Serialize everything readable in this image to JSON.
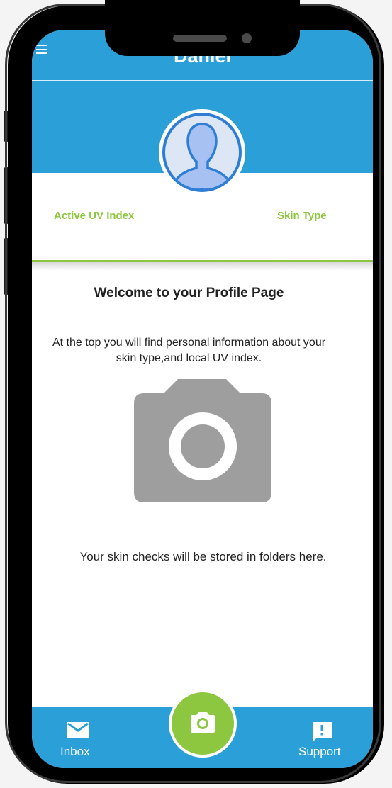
{
  "header": {
    "title": "Daniel",
    "menu_icon": "hamburger-menu-icon"
  },
  "profile": {
    "avatar_icon": "user-avatar-icon",
    "active_uv_label": "Active UV Index",
    "skin_type_label": "Skin Type"
  },
  "content": {
    "welcome_heading": "Welcome to your Profile Page",
    "intro_line1": "At the top you will find personal information about your",
    "intro_line2": "skin type,and local UV index.",
    "placeholder_icon": "camera-icon",
    "storage_text": "Your skin checks will be stored in folders here."
  },
  "bottom_nav": {
    "inbox_label": "Inbox",
    "support_label": "Support",
    "camera_icon": "camera-icon"
  },
  "colors": {
    "primary_blue": "#2b9fd8",
    "accent_green": "#8dc63f"
  }
}
